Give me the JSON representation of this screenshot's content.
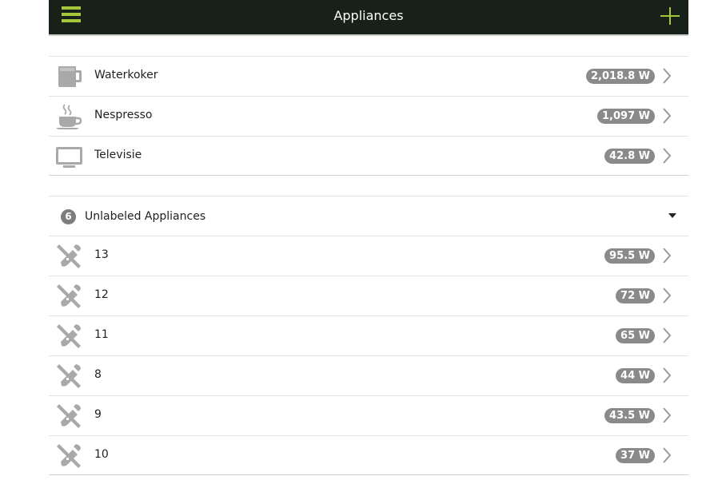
{
  "header": {
    "title": "Appliances",
    "menu_icon": "hamburger-menu-icon",
    "add_icon": "plus-icon"
  },
  "colors": {
    "header_bg": "#172019",
    "accent": "#a4c639",
    "badge": "#8a8a8a"
  },
  "labeled": [
    {
      "name": "Waterkoker",
      "power": "2,018.8 W",
      "icon": "kettle-icon"
    },
    {
      "name": "Nespresso",
      "power": "1,097 W",
      "icon": "coffee-cup-icon"
    },
    {
      "name": "Televisie",
      "power": "42.8 W",
      "icon": "tv-icon"
    }
  ],
  "unlabeled": {
    "count": "6",
    "title": "Unlabeled Appliances",
    "items": [
      {
        "name": "13",
        "power": "95.5 W"
      },
      {
        "name": "12",
        "power": "72 W"
      },
      {
        "name": "11",
        "power": "65 W"
      },
      {
        "name": "8",
        "power": "44 W"
      },
      {
        "name": "9",
        "power": "43.5 W"
      },
      {
        "name": "10",
        "power": "37 W"
      }
    ]
  }
}
